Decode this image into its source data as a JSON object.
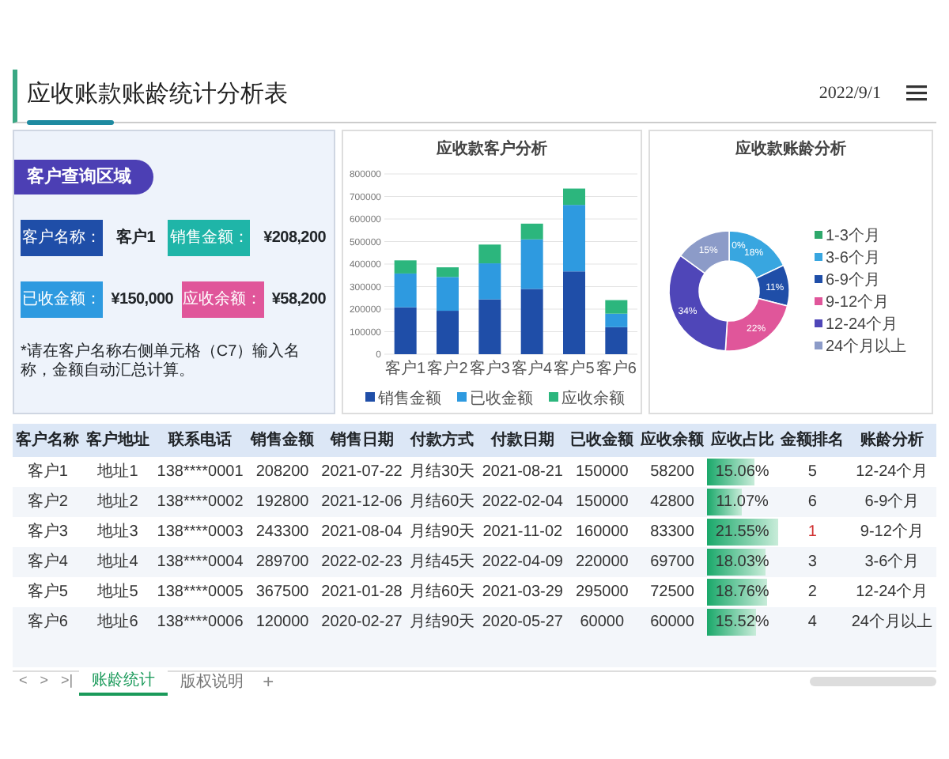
{
  "header": {
    "title": "应收账款账龄统计分析表",
    "date": "2022/9/1"
  },
  "query_panel": {
    "title": "客户查询区域",
    "fields": [
      {
        "label": "客户名称：",
        "value": "客户1",
        "color": "#1f4ea8"
      },
      {
        "label": "销售金额：",
        "value": "¥208,200",
        "color": "#1fb5a8"
      },
      {
        "label": "已收金额：",
        "value": "¥150,000",
        "color": "#2e9ae0"
      },
      {
        "label": "应收余额：",
        "value": "¥58,200",
        "color": "#e0569a"
      }
    ],
    "note": "*请在客户名称右侧单元格（C7）输入名称，金额自动汇总计算。"
  },
  "bar_chart": {
    "title": "应收款客户分析",
    "chart_data": {
      "type": "bar",
      "stacked": true,
      "categories": [
        "客户1",
        "客户2",
        "客户3",
        "客户4",
        "客户5",
        "客户6"
      ],
      "ylim": [
        0,
        800000
      ],
      "grid": true,
      "legend": true,
      "yticks": [
        0,
        100000,
        200000,
        300000,
        400000,
        500000,
        600000,
        700000,
        800000
      ],
      "series": [
        {
          "name": "销售金额",
          "color": "#1f4ea8",
          "values": [
            208200,
            192800,
            243300,
            289700,
            367500,
            120000
          ]
        },
        {
          "name": "已收金额",
          "color": "#2e9ae0",
          "values": [
            150000,
            150000,
            160000,
            220000,
            295000,
            60000
          ]
        },
        {
          "name": "应收余额",
          "color": "#2cb67d",
          "values": [
            58200,
            42800,
            83300,
            69700,
            72500,
            60000
          ]
        }
      ]
    }
  },
  "donut_chart": {
    "title": "应收款账龄分析",
    "chart_data": {
      "type": "donut",
      "categories": [
        "1-3个月",
        "3-6个月",
        "6-9个月",
        "9-12个月",
        "12-24个月",
        "24个月以上"
      ],
      "values": [
        0,
        18,
        11,
        22,
        34,
        15
      ],
      "colors": [
        "#2ea86b",
        "#38a6e0",
        "#1f4ea8",
        "#e0569a",
        "#4f46b8",
        "#8c9bc8"
      ],
      "value_labels": [
        "0%",
        "18%",
        "11%",
        "22%",
        "34%",
        "15%"
      ],
      "legend": true
    }
  },
  "table": {
    "columns": [
      "客户名称",
      "客户地址",
      "联系电话",
      "销售金额",
      "销售日期",
      "付款方式",
      "付款日期",
      "已收金额",
      "应收余额",
      "应收占比",
      "金额排名",
      "账龄分析"
    ],
    "rows": [
      {
        "cells": [
          "客户1",
          "地址1",
          "138****0001",
          "208200",
          "2021-07-22",
          "月结30天",
          "2021-08-21",
          "150000",
          "58200",
          "15.06%",
          "5",
          "12-24个月"
        ],
        "level": 0.68,
        "top_rank": false
      },
      {
        "cells": [
          "客户2",
          "地址2",
          "138****0002",
          "192800",
          "2021-12-06",
          "月结60天",
          "2022-02-04",
          "150000",
          "42800",
          "11.07%",
          "6",
          "6-9个月"
        ],
        "level": 0.5,
        "top_rank": false
      },
      {
        "cells": [
          "客户3",
          "地址3",
          "138****0003",
          "243300",
          "2021-08-04",
          "月结90天",
          "2021-11-02",
          "160000",
          "83300",
          "21.55%",
          "1",
          "9-12个月"
        ],
        "level": 1,
        "top_rank": true
      },
      {
        "cells": [
          "客户4",
          "地址4",
          "138****0004",
          "289700",
          "2022-02-23",
          "月结45天",
          "2022-04-09",
          "220000",
          "69700",
          "18.03%",
          "3",
          "3-6个月"
        ],
        "level": 0.82,
        "top_rank": false
      },
      {
        "cells": [
          "客户5",
          "地址5",
          "138****0005",
          "367500",
          "2021-01-28",
          "月结60天",
          "2021-03-29",
          "295000",
          "72500",
          "18.76%",
          "2",
          "12-24个月"
        ],
        "level": 0.85,
        "top_rank": false
      },
      {
        "cells": [
          "客户6",
          "地址6",
          "138****0006",
          "120000",
          "2020-02-27",
          "月结90天",
          "2020-05-27",
          "60000",
          "60000",
          "15.52%",
          "4",
          "24个月以上"
        ],
        "level": 0.7,
        "top_rank": false
      }
    ]
  },
  "sheet_bar": {
    "nav": [
      "<",
      ">",
      ">|"
    ],
    "tabs": [
      {
        "label": "账龄统计",
        "selected": true
      },
      {
        "label": "版权说明",
        "selected": false
      }
    ],
    "add": "+"
  }
}
